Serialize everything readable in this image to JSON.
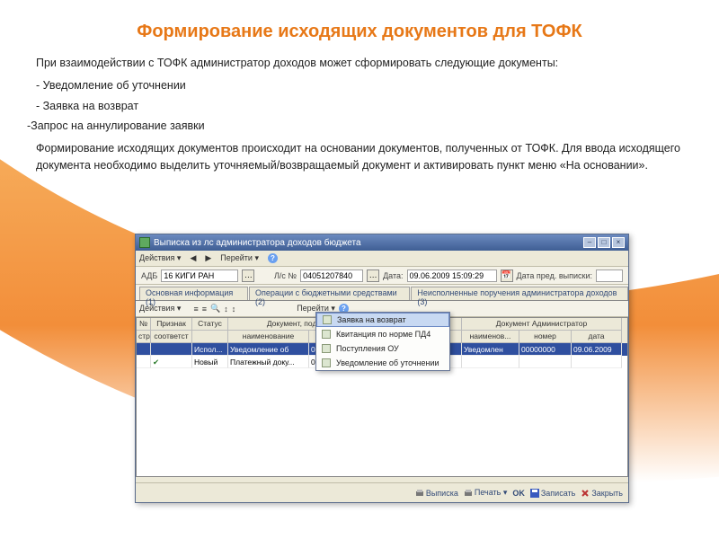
{
  "title": "Формирование исходящих документов для ТОФК",
  "intro": "При взаимодействии с ТОФК администратор доходов может сформировать следующие документы:",
  "bullets": [
    "- Уведомление об уточнении",
    "- Заявка на возврат",
    "-Запрос на аннулирование заявки"
  ],
  "para2": "Формирование исходящих документов происходит на основании документов, полученных от ТОФК. Для ввода исходящего документа необходимо выделить уточняемый/возвращаемый документ и активировать пункт меню «На основании».",
  "window": {
    "title": "Выписка из лс администратора доходов бюджета",
    "menubar": {
      "actions": "Действия ▾",
      "goto": "Перейти ▾",
      "help": "?"
    },
    "form": {
      "adb_label": "АДБ",
      "adb_value": "16 КИГИ РАН",
      "lsn_label": "Л/с №",
      "lsn_value": "04051207840",
      "date_label": "Дата:",
      "date_value": "09.06.2009 15:09:29",
      "prev_label": "Дата пред. выписки:",
      "prev_value": ""
    },
    "tabs": [
      "Основная информация (1)",
      "Операции с бюджетными средствами (2)",
      "Неисполненные поручения администратора доходов (3)"
    ],
    "subbar": {
      "actions": "Действия ▾",
      "goto": "Перейти ▾"
    },
    "grid_headers": {
      "top": [
        "№",
        "Признак",
        "Статус",
        "Документ, подтвер",
        "",
        "Документ Администратор"
      ],
      "bottom_l": [
        "стро",
        "соответст",
        "",
        "наименование",
        "номер"
      ],
      "bottom_r": [
        "наименов...",
        "номер",
        "дата"
      ]
    },
    "rows": [
      {
        "sel": true,
        "num": "",
        "prizn": "",
        "status": "Испол...",
        "dp_name": "Уведомление об",
        "dp_num": "00000000000",
        "admin_name": "Уведомлен",
        "admin_num": "00000000",
        "admin_date": "09.06.2009"
      },
      {
        "sel": false,
        "num": "",
        "prizn": "✔",
        "status": "Новый",
        "dp_name": "Платежный доку...",
        "dp_num": "000",
        "admin_name": "",
        "admin_num": "",
        "admin_date": ""
      }
    ],
    "context_menu": [
      "Заявка на возврат",
      "Квитанция по норме ПД4",
      "Поступления ОУ",
      "Уведомление об уточнении"
    ],
    "footer": {
      "vypiska": "Выписка",
      "pechat": "Печать ▾",
      "ok": "OK",
      "zapisat": "Записать",
      "zakryt": "Закрыть"
    }
  }
}
